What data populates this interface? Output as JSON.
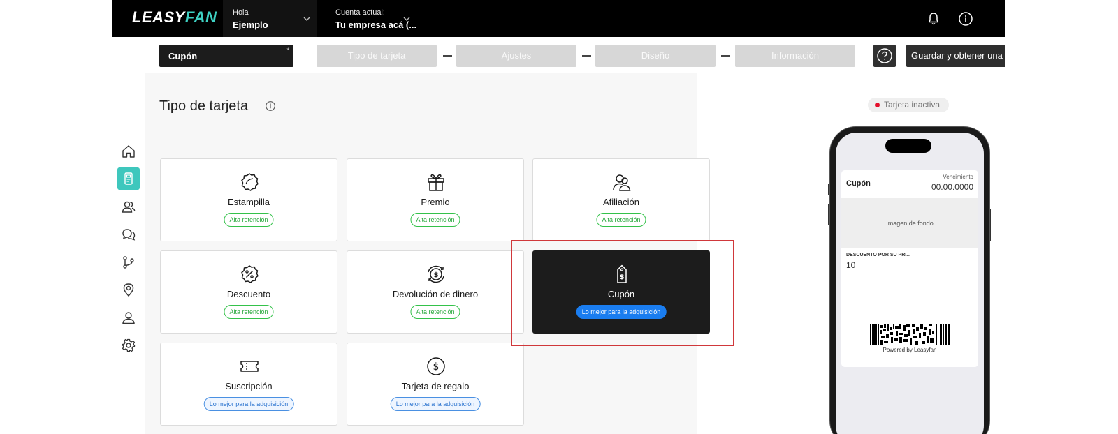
{
  "app": {
    "logo_main": "LEASY",
    "logo_accent": "FAN"
  },
  "header": {
    "greeting_label": "Hola",
    "greeting_name": "Ejemplo",
    "account_label": "Cuenta actual:",
    "account_name": "Tu empresa acá (..."
  },
  "wizard": {
    "card_name": "Cupón",
    "card_name_required": "*",
    "steps": [
      "Tipo de tarjeta",
      "Ajustes",
      "Diseño",
      "Información"
    ],
    "save_label": "Guardar y obtener una vis"
  },
  "sidebar": {
    "items": [
      {
        "icon": "home-icon"
      },
      {
        "icon": "card-icon",
        "active": true
      },
      {
        "icon": "users-icon"
      },
      {
        "icon": "chat-icon"
      },
      {
        "icon": "flow-icon"
      },
      {
        "icon": "location-icon"
      },
      {
        "icon": "user-icon"
      },
      {
        "icon": "settings-icon"
      }
    ]
  },
  "main": {
    "title": "Tipo de tarjeta",
    "card_types": [
      {
        "label": "Estampilla",
        "badge": "Alta retención",
        "icon": "stamp-icon"
      },
      {
        "label": "Premio",
        "badge": "Alta retención",
        "icon": "gift-icon"
      },
      {
        "label": "Afiliación",
        "badge": "Alta retención",
        "icon": "membership-icon"
      },
      {
        "label": "Descuento",
        "badge": "Alta retención",
        "icon": "discount-icon"
      },
      {
        "label": "Devolución de dinero",
        "badge": "Alta retención",
        "icon": "cashback-icon"
      },
      {
        "label": "Cupón",
        "badge": "Lo mejor para la adquisición",
        "icon": "coupon-tag-icon",
        "selected": true
      },
      {
        "label": "Suscripción",
        "badge": "Lo mejor para la adquisición",
        "icon": "ticket-icon"
      },
      {
        "label": "Tarjeta de regalo",
        "badge": "Lo mejor para la adquisición",
        "icon": "dollar-coin-icon"
      }
    ]
  },
  "preview": {
    "status": "Tarjeta inactiva",
    "status_color": "#e4102c",
    "card_name": "Cupón",
    "expiry_label": "Vencimiento",
    "expiry_value": "00.00.0000",
    "background_label": "Imagen de fondo",
    "field_label": "DESCUENTO POR SU PRI...",
    "field_value": "10",
    "powered_by": "Powered by Leasyfan"
  },
  "colors": {
    "accent": "#3ec7bd",
    "badge_green": "#34c24a",
    "badge_blue": "#1a7df0",
    "highlight": "#d0383b"
  }
}
